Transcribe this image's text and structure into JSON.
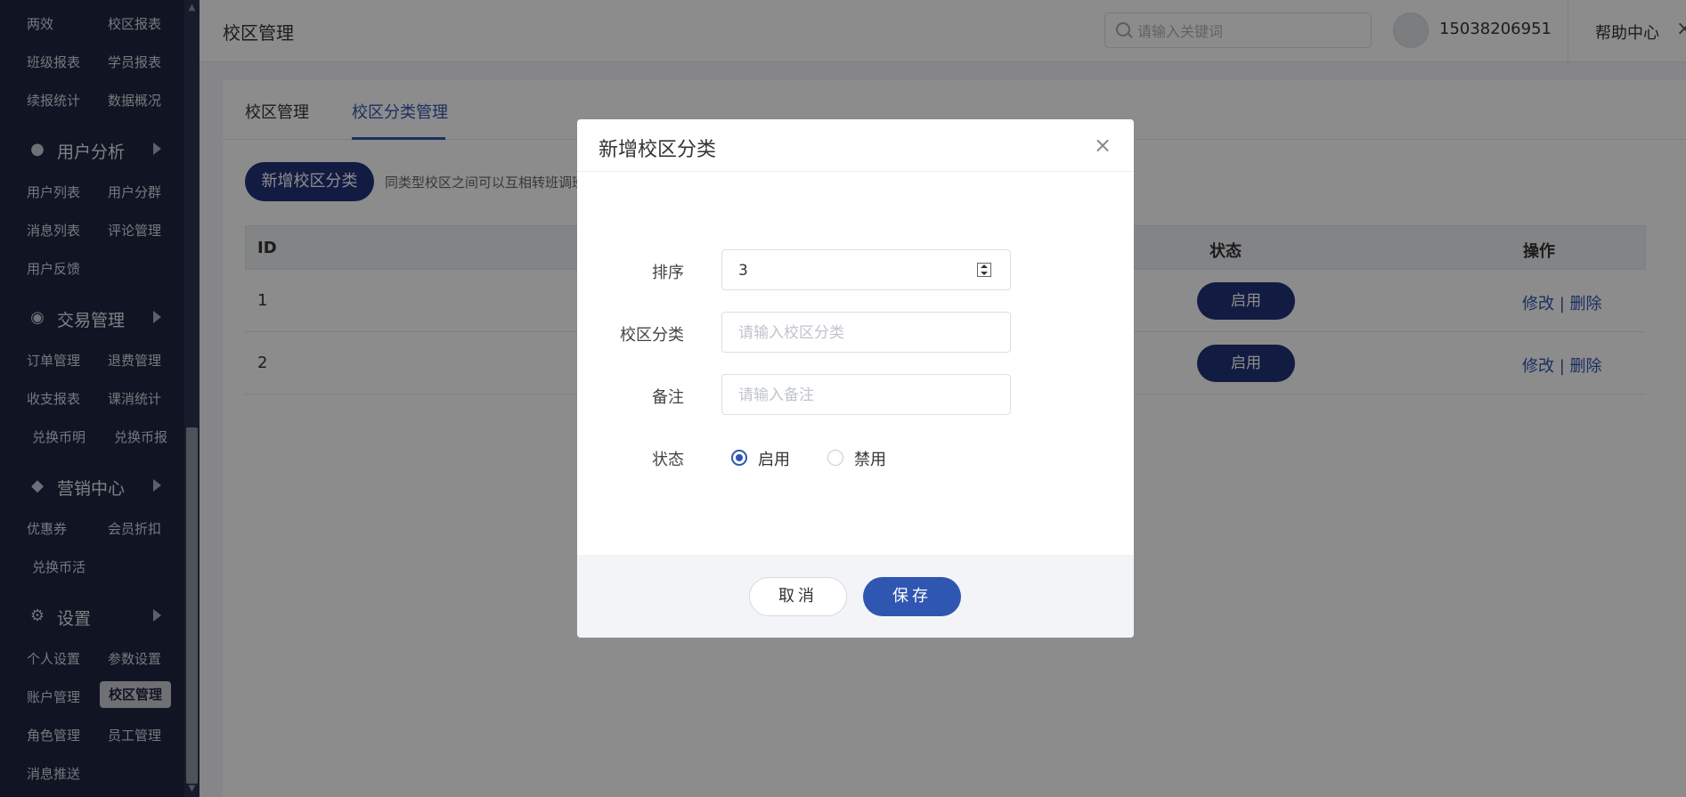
{
  "sidebar": {
    "rows": [
      {
        "c1": "两效",
        "c2": "校区报表"
      },
      {
        "c1": "班级报表",
        "c2": "学员报表"
      },
      {
        "c1": "续报统计",
        "c2": "数据概况"
      }
    ],
    "groups": [
      {
        "label": "用户分析",
        "icon": "user-icon",
        "rows": [
          {
            "c1": "用户列表",
            "c2": "用户分群"
          },
          {
            "c1": "消息列表",
            "c2": "评论管理"
          },
          {
            "c1": "用户反馈",
            "c2": ""
          }
        ]
      },
      {
        "label": "交易管理",
        "icon": "trade-icon",
        "rows": [
          {
            "c1": "订单管理",
            "c2": "退费管理"
          },
          {
            "c1": "收支报表",
            "c2": "课消统计"
          },
          {
            "c1": "兑换币明",
            "c2": "兑换币报"
          }
        ]
      },
      {
        "label": "营销中心",
        "icon": "marketing-icon",
        "rows": [
          {
            "c1": "优惠券",
            "c2": "会员折扣"
          },
          {
            "c1": "兑换币活",
            "c2": ""
          }
        ]
      },
      {
        "label": "设置",
        "icon": "gear-icon",
        "rows": [
          {
            "c1": "个人设置",
            "c2": "参数设置"
          },
          {
            "c1": "账户管理",
            "c2": "校区管理"
          },
          {
            "c1": "角色管理",
            "c2": "员工管理"
          },
          {
            "c1": "消息推送",
            "c2": ""
          }
        ]
      }
    ],
    "active_item": "校区管理"
  },
  "header": {
    "page_title": "校区管理",
    "search_placeholder": "请输入关键词",
    "phone": "15038206951",
    "help": "帮助中心",
    "close_glyph": "×"
  },
  "main": {
    "tabs": [
      "校区管理",
      "校区分类管理"
    ],
    "active_tab": "校区分类管理",
    "add_button": "新增校区分类",
    "hint": "同类型校区之间可以互相转班调班",
    "table": {
      "columns": [
        "ID",
        "状态",
        "操作"
      ],
      "rows": [
        {
          "id": "1",
          "status": "启用",
          "edit": "修改",
          "sep": "|",
          "delete": "删除"
        },
        {
          "id": "2",
          "status": "启用",
          "edit": "修改",
          "sep": "|",
          "delete": "删除"
        }
      ]
    }
  },
  "modal": {
    "title": "新增校区分类",
    "close_glyph": "×",
    "fields": {
      "sort_label": "排序",
      "sort_value": "3",
      "category_label": "校区分类",
      "category_placeholder": "请输入校区分类",
      "remark_label": "备注",
      "remark_placeholder": "请输入备注",
      "status_label": "状态",
      "status_options": [
        "启用",
        "禁用"
      ],
      "status_selected": "启用"
    },
    "cancel": "取消",
    "save": "保存"
  },
  "colors": {
    "sidebar_bg": "#1f2740",
    "primary": "#2f56b0",
    "dark_button": "#22337a"
  }
}
